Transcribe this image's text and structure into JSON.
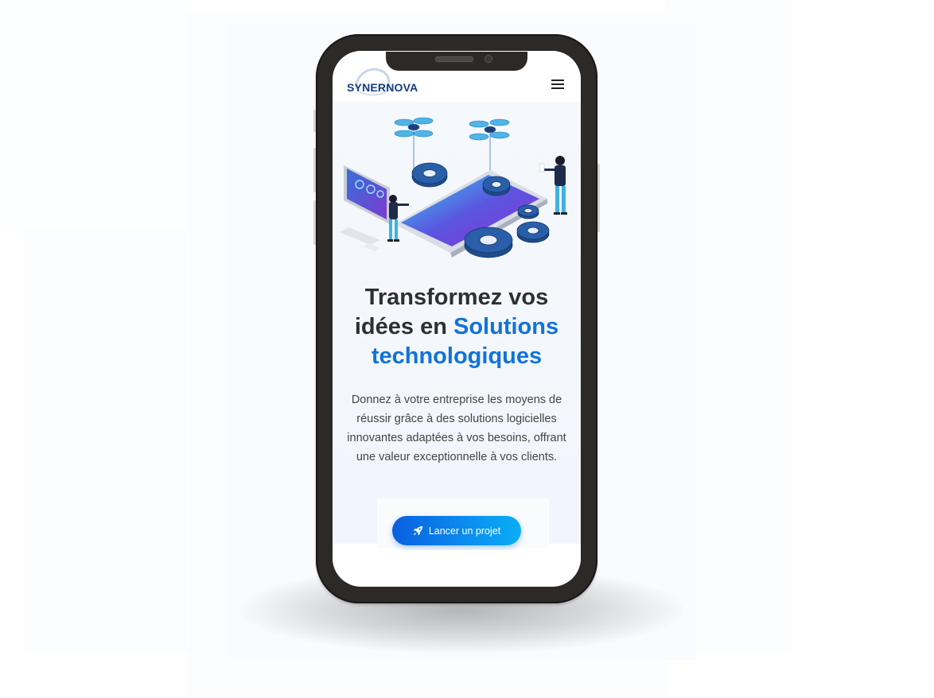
{
  "site": {
    "logo_text": "SYNERNOVA"
  },
  "hero": {
    "headline_line1": "Transformez vos",
    "headline_line2_plain": "idées en",
    "headline_line2_accent": "Solutions",
    "headline_line3_accent": "technologiques",
    "description": "Donnez à votre entreprise les moyens de réussir grâce à des solutions logicielles innovantes adaptées à vos besoins, offrant une valeur exceptionnelle à vos clients.",
    "cta_label": "Lancer un projet"
  },
  "icons": {
    "menu": "hamburger-menu-icon",
    "cta": "rocket-icon"
  },
  "colors": {
    "accent": "#1173d8",
    "headline": "#2f2f2f",
    "logo": "#123d7e",
    "phone_frame": "#2d2927",
    "cta_start": "#0a5fe0",
    "cta_end": "#0aaef5"
  }
}
